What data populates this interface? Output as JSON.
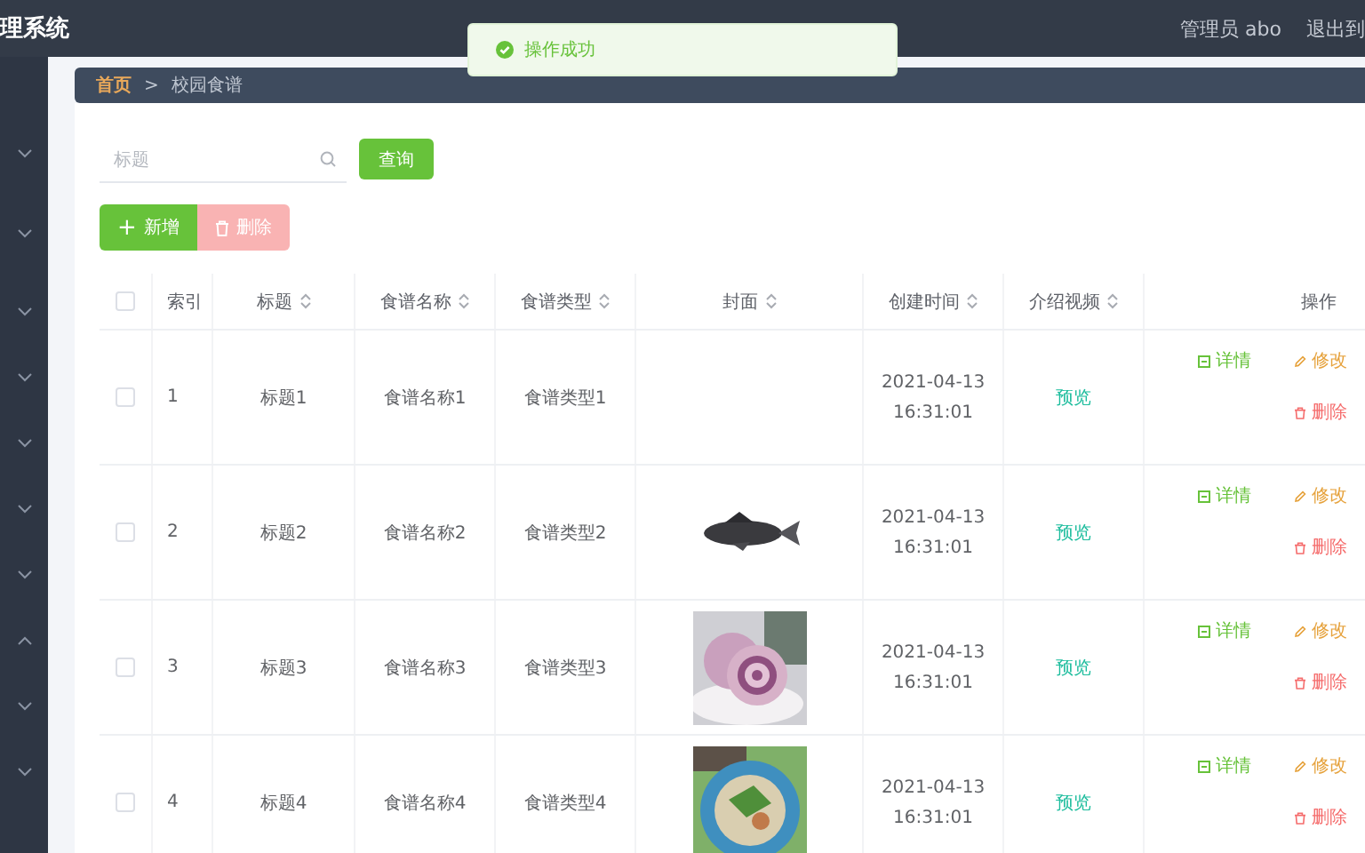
{
  "app": {
    "title": "理系统"
  },
  "toast": {
    "message": "操作成功"
  },
  "header": {
    "user": "管理员 abo",
    "logout": "退出到"
  },
  "sidebar": {
    "items": [
      {
        "expanded": false
      },
      {
        "expanded": false
      },
      {
        "expanded": false
      },
      {
        "expanded": false
      },
      {
        "expanded": false
      },
      {
        "expanded": false
      },
      {
        "expanded": false
      },
      {
        "expanded": true
      },
      {
        "expanded": false
      },
      {
        "expanded": false
      }
    ]
  },
  "breadcrumb": {
    "home": "首页",
    "separator": ">",
    "current": "校园食谱"
  },
  "search": {
    "placeholder": "标题"
  },
  "query_button": "查询",
  "add_button": {
    "icon": "+",
    "label": "新增"
  },
  "delete_button": {
    "label": "删除",
    "disabled": true
  },
  "table": {
    "select_all": {
      "checked": false
    },
    "columns": [
      {
        "label": "索引",
        "sortable": false
      },
      {
        "label": "标题",
        "sortable": true
      },
      {
        "label": "食谱名称",
        "sortable": true
      },
      {
        "label": "食谱类型",
        "sortable": true
      },
      {
        "label": "封面",
        "sortable": true
      },
      {
        "label": "创建时间",
        "sortable": true
      },
      {
        "label": "介绍视频",
        "sortable": true
      },
      {
        "label": "操作",
        "sortable": false
      }
    ],
    "rows": [
      {
        "checked": false,
        "index": "1",
        "title": "标题1",
        "name": "食谱名称1",
        "type": "食谱类型1",
        "created": "2021-04-13 16:31:01",
        "video": "预览",
        "actions": [
          {
            "kind": "detail",
            "label": "详情"
          },
          {
            "kind": "edit",
            "label": "修改"
          },
          {
            "kind": "delete",
            "label": "删除"
          }
        ]
      },
      {
        "checked": false,
        "index": "2",
        "title": "标题2",
        "name": "食谱名称2",
        "type": "食谱类型2",
        "cover": {
          "kind": "picture"
        },
        "created": "2021-04-13 16:31:01",
        "video": "预览",
        "actions": [
          {
            "kind": "detail",
            "label": "详情"
          },
          {
            "kind": "edit",
            "label": "修改"
          },
          {
            "kind": "delete",
            "label": "删除"
          }
        ]
      },
      {
        "checked": false,
        "index": "3",
        "title": "标题3",
        "name": "食谱名称3",
        "type": "食谱类型3",
        "cover": {
          "kind": "picture"
        },
        "created": "2021-04-13 16:31:01",
        "video": "预览",
        "actions": [
          {
            "kind": "detail",
            "label": "详情"
          },
          {
            "kind": "edit",
            "label": "修改"
          },
          {
            "kind": "delete",
            "label": "删除"
          }
        ]
      },
      {
        "checked": false,
        "index": "4",
        "title": "标题4",
        "name": "食谱名称4",
        "type": "食谱类型4",
        "cover": {
          "kind": "picture"
        },
        "created": "2021-04-13 16:31:01",
        "video": "预览",
        "actions": [
          {
            "kind": "detail",
            "label": "详情"
          },
          {
            "kind": "edit",
            "label": "修改"
          },
          {
            "kind": "delete",
            "label": "删除"
          }
        ]
      }
    ]
  }
}
